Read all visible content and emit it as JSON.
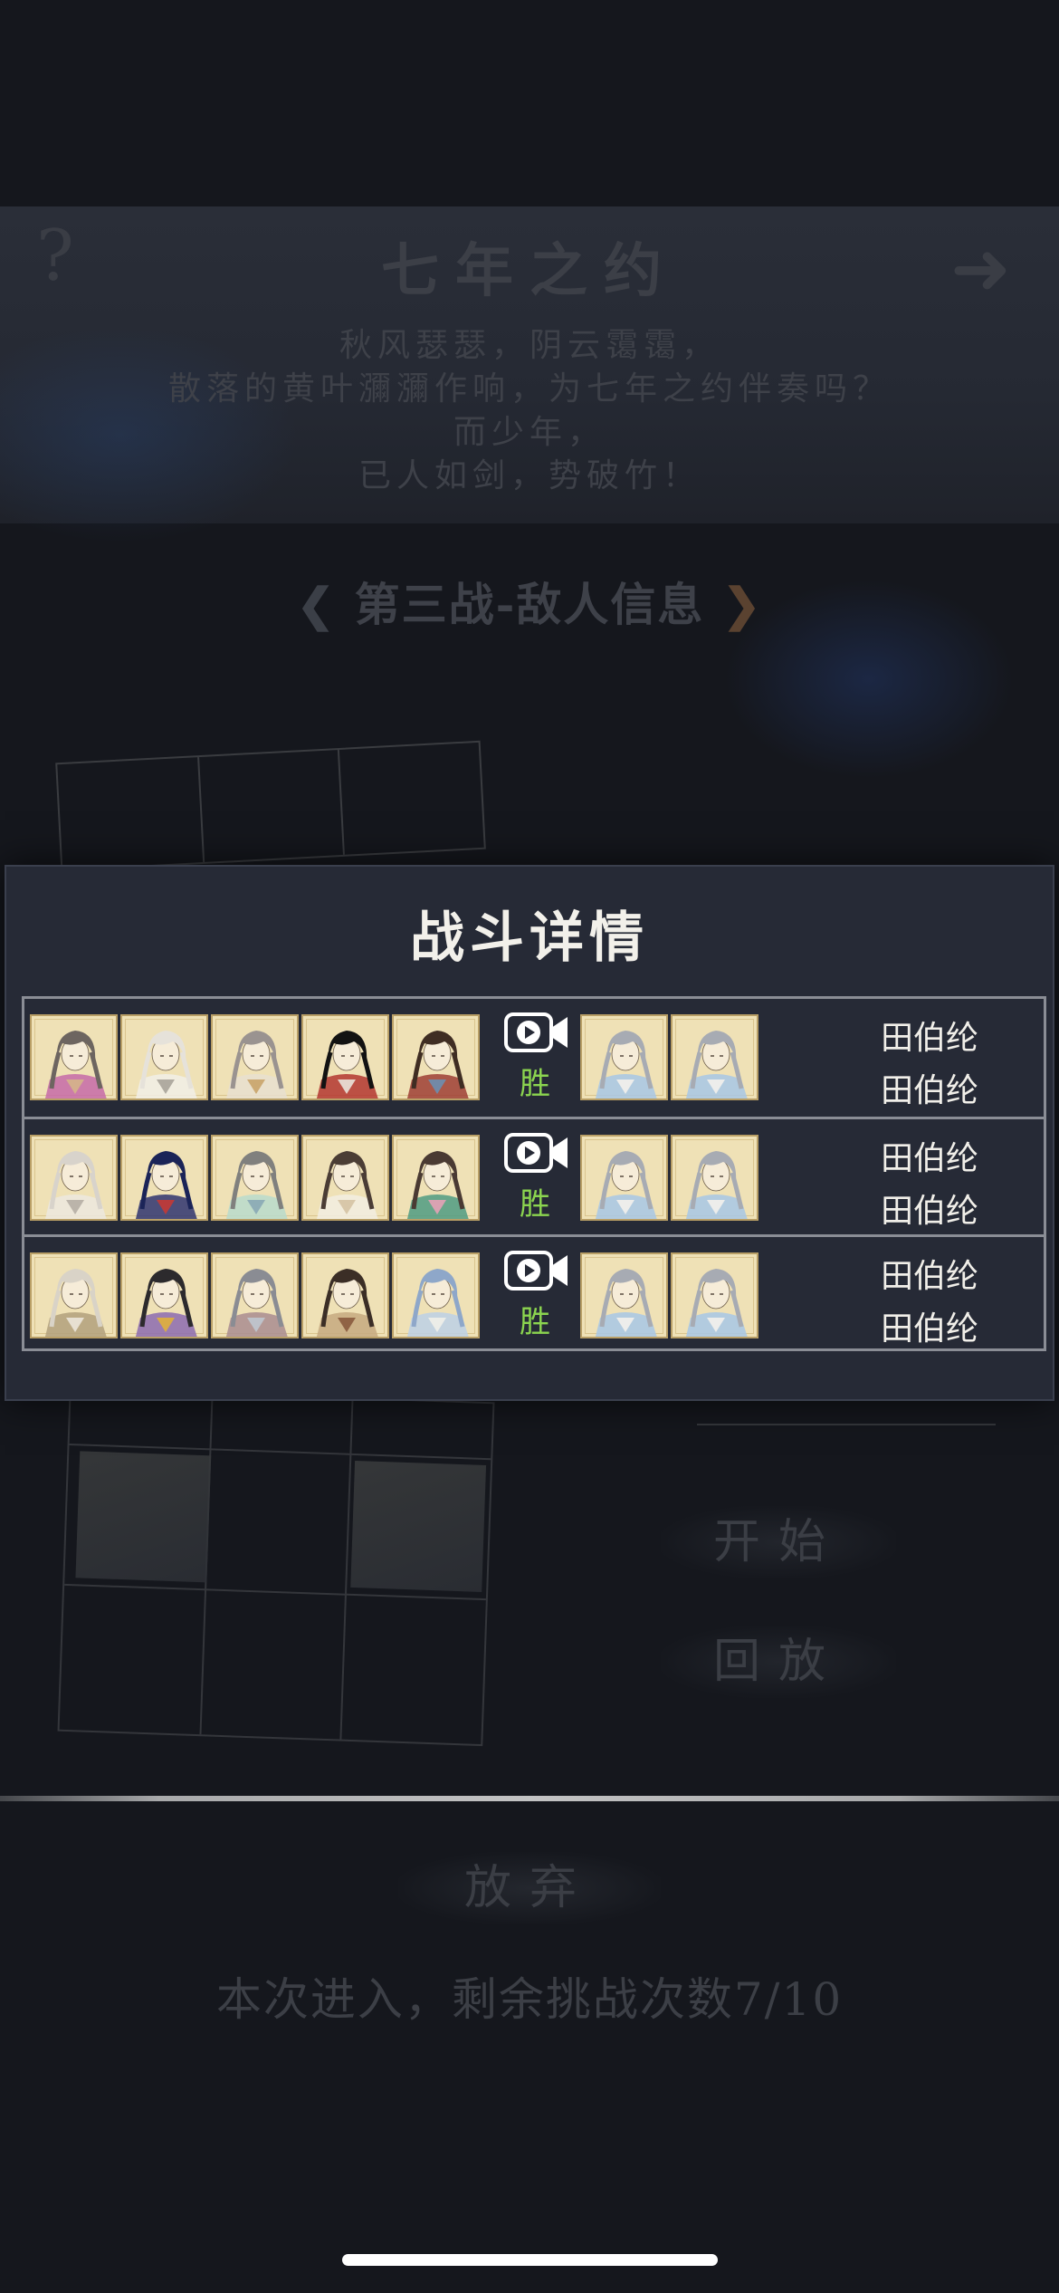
{
  "background": {
    "help_glyph": "?",
    "arrow_glyph": "➜",
    "stage_title": "七年之约",
    "poem_lines": [
      "秋风瑟瑟，阴云霭霭，",
      "散落的黄叶瀰瀰作响，为七年之约伴奏吗？",
      "而少年，",
      "已人如剑，势破竹！"
    ],
    "battle_nav": {
      "prev_glyph": "❮",
      "label": "第三战-敌人信息",
      "next_glyph": "❯"
    },
    "start_button": "开始",
    "replay_button": "回放",
    "give_up_button": "放弃",
    "remaining_text": "本次进入，剩余挑战次数7/10"
  },
  "modal": {
    "title": "战斗详情",
    "rows": [
      {
        "team": [
          {
            "hair": "#6d6560",
            "robe": "#c56aa8",
            "accent": "#d5b48a"
          },
          {
            "hair": "#e6e2da",
            "robe": "#f1efe8",
            "accent": "#a9a39a"
          },
          {
            "hair": "#9a9390",
            "robe": "#e8dfd0",
            "accent": "#c9a46a"
          },
          {
            "hair": "#121212",
            "robe": "#b33630",
            "accent": "#e9e3da"
          },
          {
            "hair": "#3f2d23",
            "robe": "#9d3e35",
            "accent": "#6c8fb0"
          }
        ],
        "replay_icon": "video-camera-play-icon",
        "result": "胜",
        "enemy_team": [
          {
            "hair": "#a7abb3",
            "robe": "#a7c7e6",
            "accent": "#f3f1ec"
          },
          {
            "hair": "#a7abb3",
            "robe": "#a7c7e6",
            "accent": "#f3f1ec"
          }
        ],
        "enemy_names": [
          "田伯纶",
          "田伯纶"
        ]
      },
      {
        "team": [
          {
            "hair": "#d8d3cb",
            "robe": "#ece8df",
            "accent": "#b5aea4"
          },
          {
            "hair": "#1b2458",
            "robe": "#2f3470",
            "accent": "#c43a35"
          },
          {
            "hair": "#80807e",
            "robe": "#b9dacd",
            "accent": "#8aa9b5"
          },
          {
            "hair": "#4b3d35",
            "robe": "#f2ede2",
            "accent": "#d5c3a3"
          },
          {
            "hair": "#4a3a33",
            "robe": "#4f9b83",
            "accent": "#e5a2b6"
          }
        ],
        "replay_icon": "video-camera-play-icon",
        "result": "胜",
        "enemy_team": [
          {
            "hair": "#a7abb3",
            "robe": "#a7c7e6",
            "accent": "#f3f1ec"
          },
          {
            "hair": "#a7abb3",
            "robe": "#a7c7e6",
            "accent": "#f3f1ec"
          }
        ],
        "enemy_names": [
          "田伯纶",
          "田伯纶"
        ]
      },
      {
        "team": [
          {
            "hair": "#d9d3c7",
            "robe": "#b2a07d",
            "accent": "#ece6da"
          },
          {
            "hair": "#2c2a2d",
            "robe": "#8c6bb0",
            "accent": "#e0b03c"
          },
          {
            "hair": "#8a8c93",
            "robe": "#a98c90",
            "accent": "#bfc7cf"
          },
          {
            "hair": "#3b2e26",
            "robe": "#c5a980",
            "accent": "#8a5a3e"
          },
          {
            "hair": "#8ea7c9",
            "robe": "#bcd0e6",
            "accent": "#f1efe9"
          }
        ],
        "replay_icon": "video-camera-play-icon",
        "result": "胜",
        "enemy_team": [
          {
            "hair": "#a7abb3",
            "robe": "#a7c7e6",
            "accent": "#f3f1ec"
          },
          {
            "hair": "#a7abb3",
            "robe": "#a7c7e6",
            "accent": "#f3f1ec"
          }
        ],
        "enemy_names": [
          "田伯纶",
          "田伯纶"
        ]
      }
    ]
  },
  "colors": {
    "modal_bg": "#262a36",
    "win": "#8bd44f",
    "portrait_paper": "#efe1b6"
  }
}
